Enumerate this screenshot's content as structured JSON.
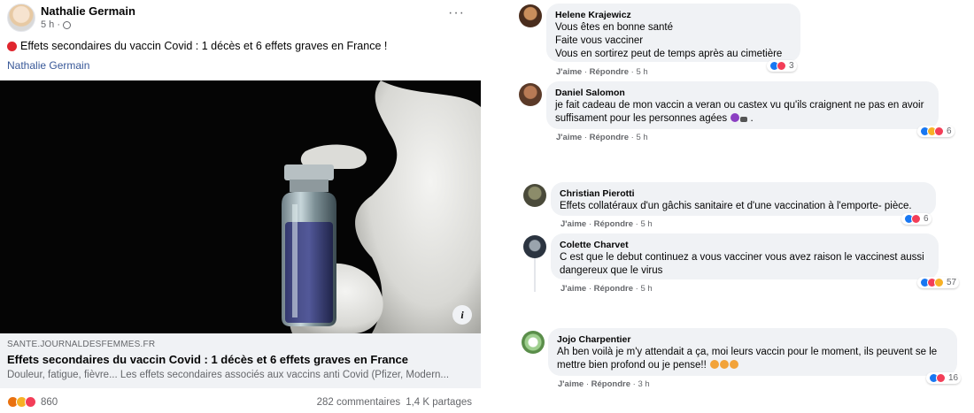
{
  "post": {
    "author": "Nathalie Germain",
    "time": "5 h ·",
    "text": "Effets secondaires du vaccin Covid : 1 décès et 6 effets graves en France !",
    "link_name": "Nathalie Germain",
    "more_label": "···",
    "link_card": {
      "domain": "SANTE.JOURNALDESFEMMES.FR",
      "title": "Effets secondaires du vaccin Covid : 1 décès et 6 effets graves en France",
      "description": "Douleur, fatigue, fièvre... Les effets secondaires associés aux vaccins anti Covid (Pfizer, Modern..."
    },
    "info_label": "i",
    "reaction_count": "860",
    "comments_count": "282 commentaires",
    "shares_count": "1,4 K partages",
    "icons": [
      "globe-icon",
      "red-dot-icon",
      "info-icon",
      "more-icon"
    ]
  },
  "comments": [
    {
      "name": "Helene Krajewicz",
      "lines": [
        "Vous êtes en bonne santé",
        "Faite vous vacciner",
        "Vous en sortirez peut de temps après au cimetière"
      ],
      "like": "J'aime",
      "reply": "Répondre",
      "time": "5 h",
      "reactions": [
        "like",
        "love"
      ],
      "count": "3"
    },
    {
      "name": "Daniel Salomon",
      "lines": [
        "je fait cadeau de mon vaccin a veran ou castex vu qu'ils craignent ne pas en avoir",
        "suffisament pour les personnes agées"
      ],
      "like": "J'aime",
      "reply": "Répondre",
      "time": "5 h",
      "reactions": [
        "like",
        "haha",
        "love"
      ],
      "count": "6"
    },
    {
      "name": "Christian Pierotti",
      "lines": [
        "Effets collatéraux d'un gâchis sanitaire et d'une vaccination à l'emporte- pièce."
      ],
      "like": "J'aime",
      "reply": "Répondre",
      "time": "5 h",
      "reactions": [
        "like",
        "love"
      ],
      "count": "6"
    },
    {
      "name": "Colette Charvet",
      "lines": [
        "C est que le debut continuez a vous vacciner vous avez raison le vaccinest aussi",
        "dangereux que le virus"
      ],
      "like": "J'aime",
      "reply": "Répondre",
      "time": "5 h",
      "reactions": [
        "like",
        "love",
        "haha"
      ],
      "count": "57"
    },
    {
      "name": "Jojo Charpentier",
      "lines": [
        "Ah ben voilà je m'y attendait a ça, moi leurs vaccin pour le moment, ils peuvent se le",
        "mettre bien profond ou je pense!!"
      ],
      "like": "J'aime",
      "reply": "Répondre",
      "time": "3 h",
      "reactions": [
        "like",
        "love"
      ],
      "count": "16"
    }
  ],
  "colors": {
    "link": "#385898",
    "secondary": "#65676b",
    "bubble": "#f0f2f5",
    "like": "#1877f2",
    "love": "#f33e58",
    "haha": "#f7b125",
    "angry": "#e9710f"
  }
}
